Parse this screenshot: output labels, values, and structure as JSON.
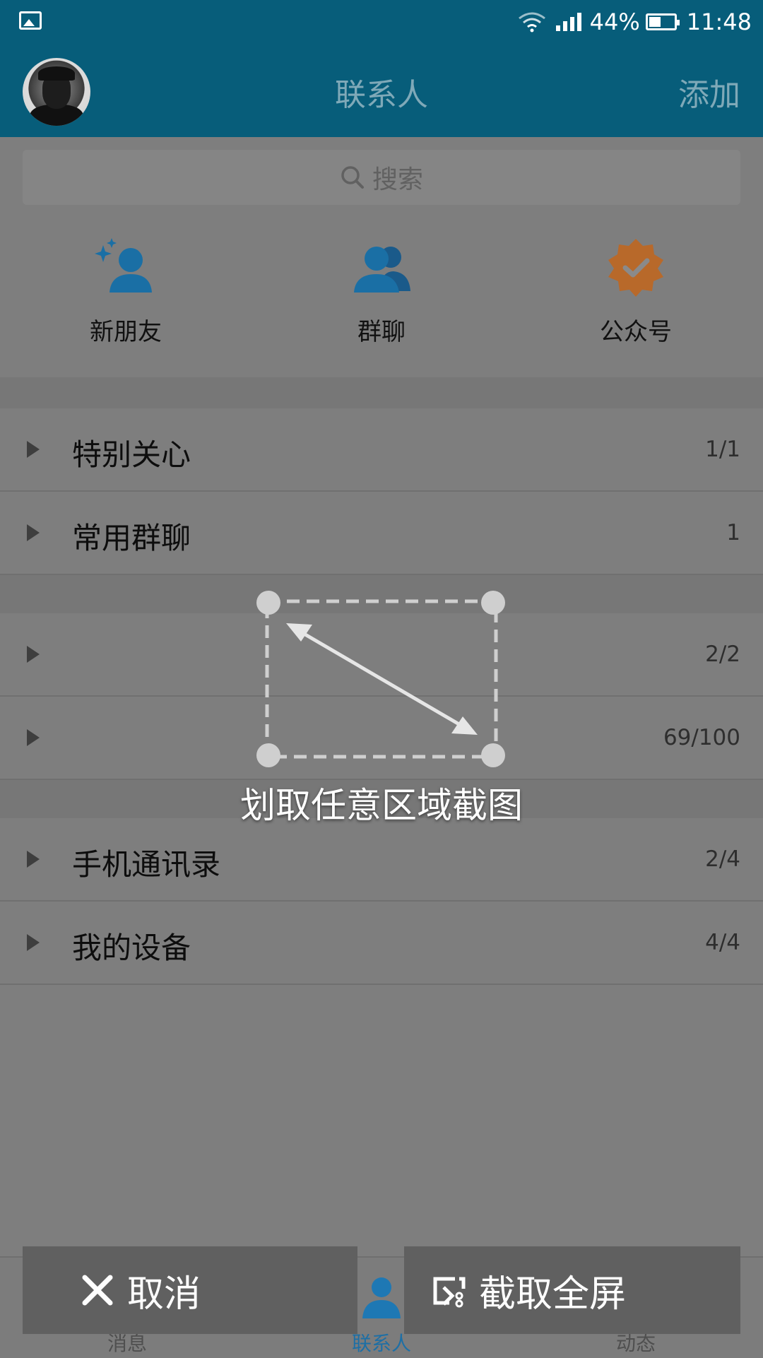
{
  "status_bar": {
    "battery": "44%",
    "time": "11:48"
  },
  "header": {
    "title": "联系人",
    "action": "添加"
  },
  "search": {
    "placeholder": "搜索"
  },
  "shortcuts": [
    {
      "label": "新朋友",
      "icon": "new-friend-icon"
    },
    {
      "label": "群聊",
      "icon": "group-chat-icon"
    },
    {
      "label": "公众号",
      "icon": "official-account-icon"
    }
  ],
  "groups": [
    {
      "name": "特别关心",
      "count": "1/1"
    },
    {
      "name": "常用群聊",
      "count": "1"
    },
    {
      "name": "",
      "count": "2/2"
    },
    {
      "name": "",
      "count": "69/100"
    },
    {
      "name": "手机通讯录",
      "count": "2/4"
    },
    {
      "name": "我的设备",
      "count": "4/4"
    }
  ],
  "tabs": [
    {
      "label": "消息",
      "icon": "chat-bubble-icon"
    },
    {
      "label": "联系人",
      "icon": "contact-person-icon",
      "active": true
    },
    {
      "label": "动态",
      "icon": "star-icon"
    }
  ],
  "overlay": {
    "hint": "划取任意区域截图",
    "cancel_label": "取消",
    "fullscreen_label": "截取全屏"
  },
  "colors": {
    "header": "#075d7a",
    "accent": "#1e88c8",
    "dim_overlay": "#7e7e7e"
  }
}
